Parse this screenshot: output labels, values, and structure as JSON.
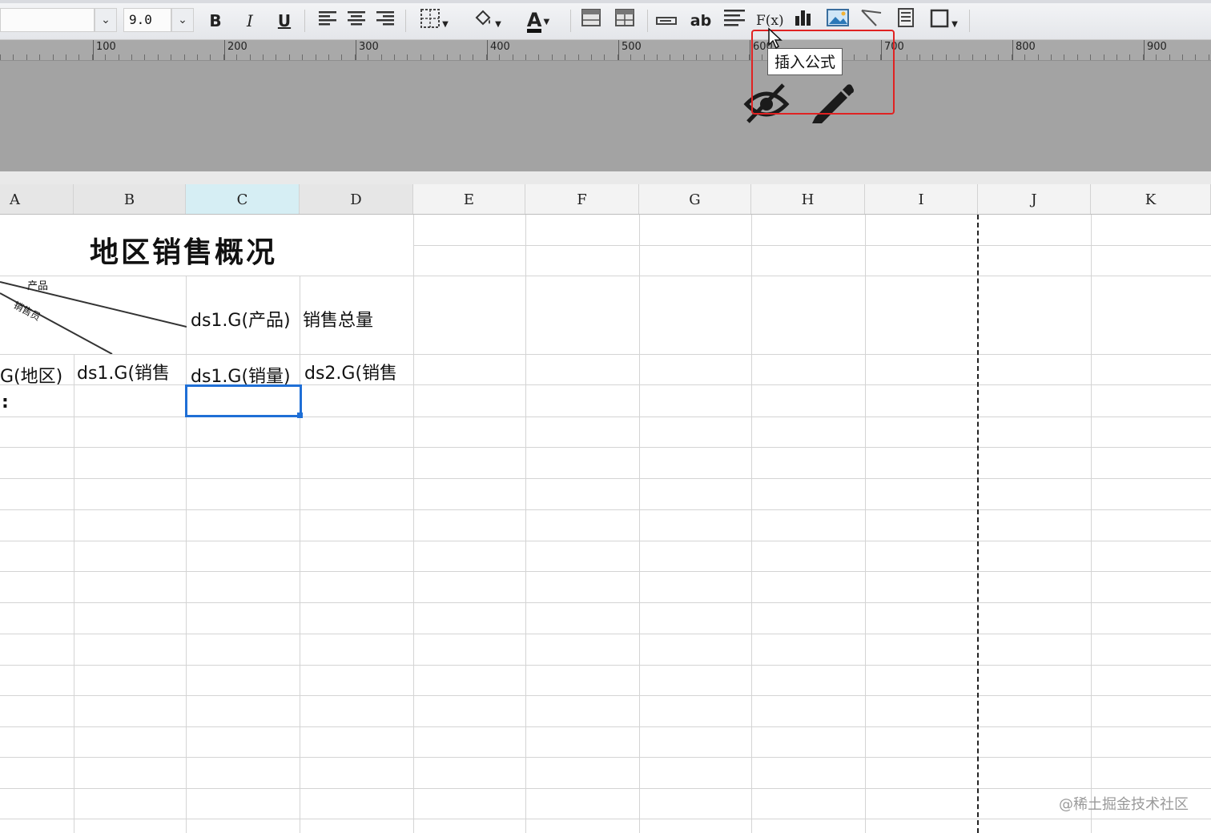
{
  "toolbar": {
    "font_size_value": "9.0",
    "bold_label": "B",
    "italic_label": "I",
    "underline_label": "U",
    "text_color_label": "A",
    "wrap_label": "ab",
    "formula_label": "F(x)",
    "icons": [
      "chevron-down-icon",
      "bold-icon",
      "italic-icon",
      "underline-icon",
      "align-left-icon",
      "align-center-icon",
      "align-right-icon",
      "border-icon",
      "fill-color-icon",
      "font-color-icon",
      "merge-cells-icon",
      "split-cells-icon",
      "input-field-icon",
      "wrap-text-icon",
      "paragraph-icon",
      "insert-formula-icon",
      "chart-icon",
      "image-icon",
      "slash-icon",
      "sub-report-icon",
      "frame-icon"
    ]
  },
  "ruler": {
    "labels": [
      "100",
      "200",
      "300",
      "400",
      "500",
      "600",
      "700",
      "800",
      "900"
    ]
  },
  "tooltip": {
    "text": "插入公式"
  },
  "columns": [
    "A",
    "B",
    "C",
    "D",
    "E",
    "F",
    "G",
    "H",
    "I",
    "J",
    "K"
  ],
  "report": {
    "title": "地区销售概况",
    "slash_header_top": "产品",
    "slash_header_mid": "销售员",
    "c_header": "ds1.G(产品)",
    "d_header": "销售总量",
    "a_data": "G(地区)",
    "b_data": "ds1.G(销售",
    "c_data": "ds1.G(销量)",
    "d_data": "ds2.G(销售",
    "a_row4": ":"
  },
  "watermark": "@稀土掘金技术社区",
  "colors": {
    "selection": "#1f6fd6",
    "highlight": "#e02222",
    "active_column": "#d6eef4"
  }
}
